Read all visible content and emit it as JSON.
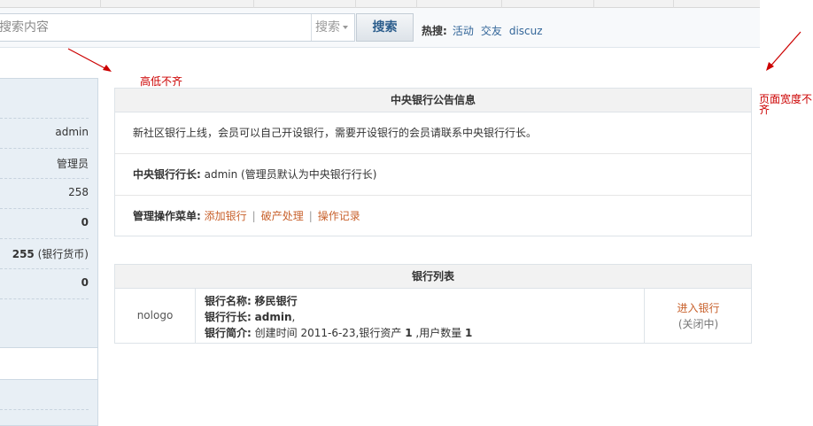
{
  "search": {
    "placeholder": "搜索内容",
    "type_label": "搜索",
    "button_label": "搜索"
  },
  "hot": {
    "label": "热搜:",
    "links": [
      "活动",
      "交友",
      "discuz"
    ]
  },
  "sidebar": {
    "values": [
      "admin",
      "管理员",
      "258",
      "0",
      "255",
      "(银行货币)",
      "0"
    ]
  },
  "annotations": {
    "height_note": "高低不齐",
    "width_note": "页面宽度不齐"
  },
  "announcement": {
    "title": "中央银行公告信息",
    "message": "新社区银行上线，会员可以自己开设银行，需要开设银行的会员请联系中央银行行长。",
    "governor_label": "中央银行行长:",
    "governor_value": "admin (管理员默认为中央银行行长)",
    "menu_label": "管理操作菜单:",
    "menu_items": [
      "添加银行",
      "破产处理",
      "操作记录"
    ]
  },
  "bank_list": {
    "title": "银行列表",
    "rows": [
      {
        "logo": "nologo",
        "name_label": "银行名称:",
        "name": "移民银行",
        "governor_label": "银行行长:",
        "governor": "admin",
        "governor_suffix": ",",
        "intro_label": "银行简介:",
        "intro_created": "创建时间 2011-6-23,银行资产",
        "intro_assets": "1",
        "intro_users_label": ",用户数量",
        "intro_users": "1",
        "action": "进入银行",
        "status": "(关闭中)"
      }
    ]
  },
  "colors": {
    "accent_link": "#336699",
    "action_link": "#c8612c",
    "annotation": "#cc0000",
    "sidebar_bg": "#e8eff5"
  }
}
